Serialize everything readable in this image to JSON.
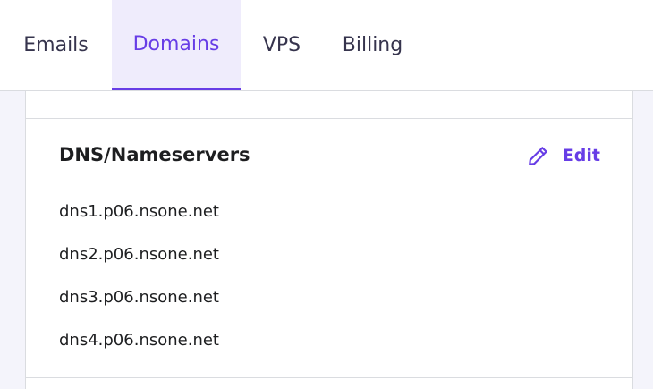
{
  "tabs": [
    {
      "label": "Emails",
      "active": false
    },
    {
      "label": "Domains",
      "active": true
    },
    {
      "label": "VPS",
      "active": false
    },
    {
      "label": "Billing",
      "active": false
    }
  ],
  "dns_section": {
    "title": "DNS/Nameservers",
    "edit_label": "Edit",
    "edit_icon": "pencil-icon",
    "nameservers": [
      "dns1.p06.nsone.net",
      "dns2.p06.nsone.net",
      "dns3.p06.nsone.net",
      "dns4.p06.nsone.net"
    ]
  },
  "colors": {
    "accent": "#673de6",
    "active_tab_bg": "#efecfc",
    "page_bg": "#f4f4fb",
    "text_dark": "#1d1e20"
  }
}
